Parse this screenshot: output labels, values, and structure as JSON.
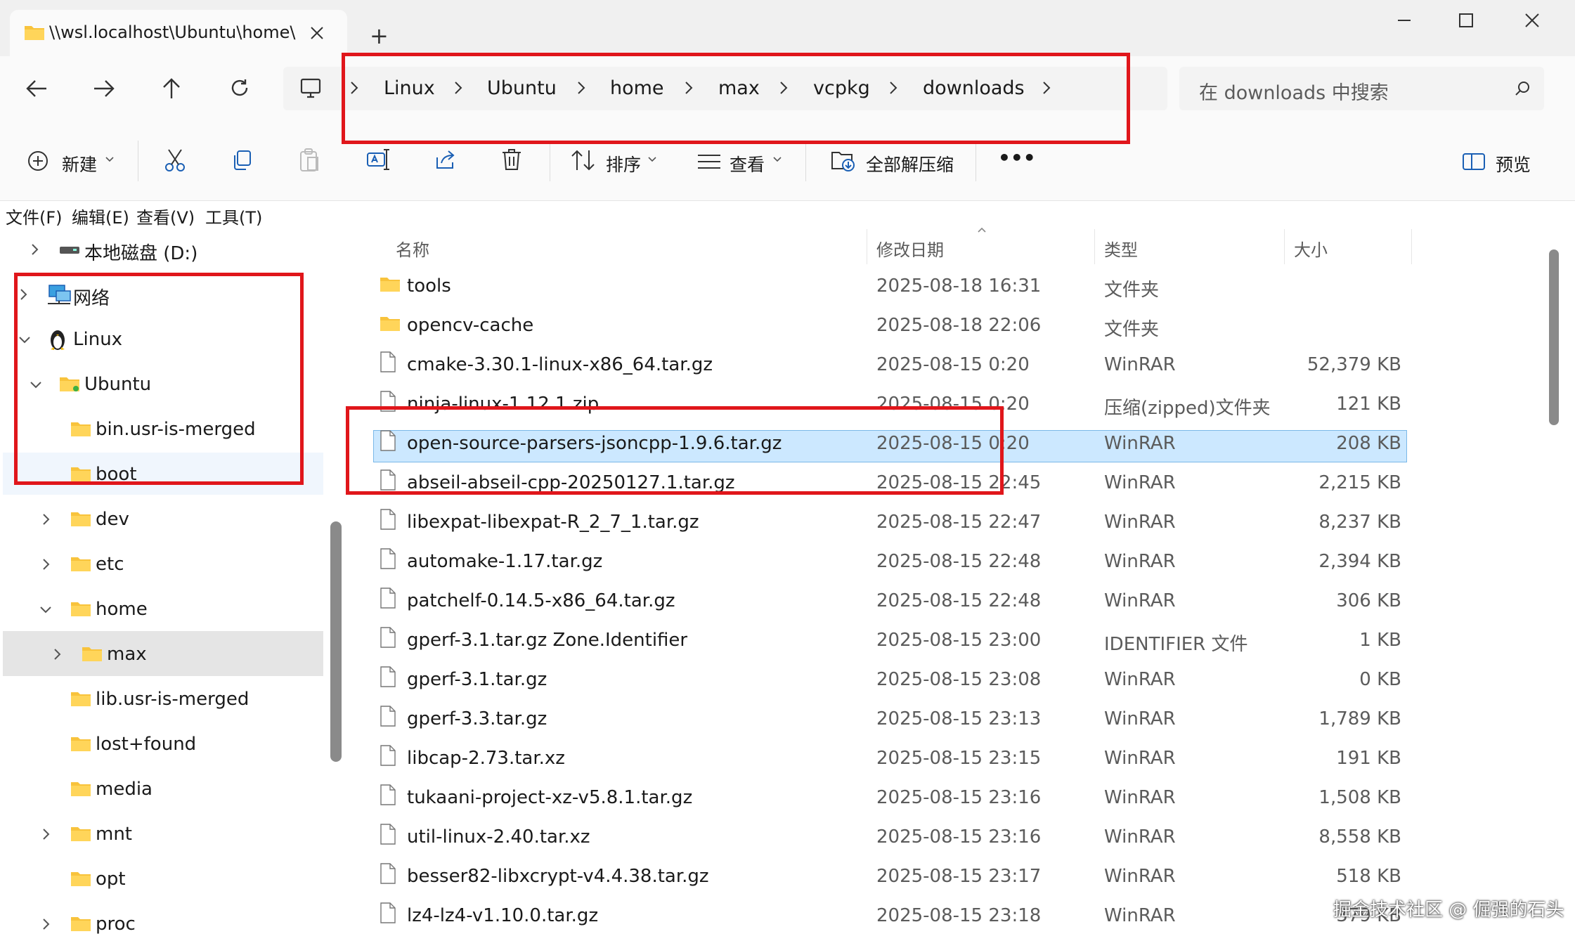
{
  "window": {
    "tab_title": "\\\\wsl.localhost\\Ubuntu\\home\\",
    "new_tab_symbol": "+"
  },
  "breadcrumb": [
    "Linux",
    "Ubuntu",
    "home",
    "max",
    "vcpkg",
    "downloads"
  ],
  "search": {
    "placeholder": "在 downloads 中搜索"
  },
  "commandbar": {
    "new_label": "新建",
    "sort_label": "排序",
    "view_label": "查看",
    "extract_all_label": "全部解压缩",
    "more_label": "•••",
    "preview_label": "预览"
  },
  "menubar": [
    "文件(F)",
    "编辑(E)",
    "查看(V)",
    "工具(T)"
  ],
  "nav": {
    "local_disk": "本地磁盘 (D:)",
    "network": "网络",
    "linux": "Linux",
    "ubuntu": "Ubuntu",
    "folders": [
      "bin.usr-is-merged",
      "boot",
      "dev",
      "etc",
      "home",
      "max",
      "lib.usr-is-merged",
      "lost+found",
      "media",
      "mnt",
      "opt",
      "proc"
    ]
  },
  "columns": {
    "name": "名称",
    "date": "修改日期",
    "type": "类型",
    "size": "大小"
  },
  "files": [
    {
      "name": "tools",
      "date": "2025-08-18 16:31",
      "type": "文件夹",
      "size": ""
    },
    {
      "name": "opencv-cache",
      "date": "2025-08-18 22:06",
      "type": "文件夹",
      "size": ""
    },
    {
      "name": "cmake-3.30.1-linux-x86_64.tar.gz",
      "date": "2025-08-15 0:20",
      "type": "WinRAR",
      "size": "52,379 KB"
    },
    {
      "name": "ninja-linux-1.12.1.zip",
      "date": "2025-08-15 0:20",
      "type": "压缩(zipped)文件夹",
      "size": "121 KB"
    },
    {
      "name": "open-source-parsers-jsoncpp-1.9.6.tar.gz",
      "date": "2025-08-15 0:20",
      "type": "WinRAR",
      "size": "208 KB"
    },
    {
      "name": "abseil-abseil-cpp-20250127.1.tar.gz",
      "date": "2025-08-15 22:45",
      "type": "WinRAR",
      "size": "2,215 KB"
    },
    {
      "name": "libexpat-libexpat-R_2_7_1.tar.gz",
      "date": "2025-08-15 22:47",
      "type": "WinRAR",
      "size": "8,237 KB"
    },
    {
      "name": "automake-1.17.tar.gz",
      "date": "2025-08-15 22:48",
      "type": "WinRAR",
      "size": "2,394 KB"
    },
    {
      "name": "patchelf-0.14.5-x86_64.tar.gz",
      "date": "2025-08-15 22:48",
      "type": "WinRAR",
      "size": "306 KB"
    },
    {
      "name": "gperf-3.1.tar.gz   Zone.Identifier",
      "date": "2025-08-15 23:00",
      "type": "IDENTIFIER 文件",
      "size": "1 KB"
    },
    {
      "name": "gperf-3.1.tar.gz",
      "date": "2025-08-15 23:08",
      "type": "WinRAR",
      "size": "0 KB"
    },
    {
      "name": "gperf-3.3.tar.gz",
      "date": "2025-08-15 23:13",
      "type": "WinRAR",
      "size": "1,789 KB"
    },
    {
      "name": "libcap-2.73.tar.xz",
      "date": "2025-08-15 23:15",
      "type": "WinRAR",
      "size": "191 KB"
    },
    {
      "name": "tukaani-project-xz-v5.8.1.tar.gz",
      "date": "2025-08-15 23:16",
      "type": "WinRAR",
      "size": "1,508 KB"
    },
    {
      "name": "util-linux-2.40.tar.xz",
      "date": "2025-08-15 23:16",
      "type": "WinRAR",
      "size": "8,558 KB"
    },
    {
      "name": "besser82-libxcrypt-v4.4.38.tar.gz",
      "date": "2025-08-15 23:17",
      "type": "WinRAR",
      "size": "518 KB"
    },
    {
      "name": "lz4-lz4-v1.10.0.tar.gz",
      "date": "2025-08-15 23:18",
      "type": "WinRAR",
      "size": "379 KB"
    }
  ],
  "watermark": "掘金技术社区 @ 倔强的石头",
  "colors": {
    "accent_red": "#e0161b",
    "selection": "#cce8ff",
    "folder": "#f8c33c"
  }
}
